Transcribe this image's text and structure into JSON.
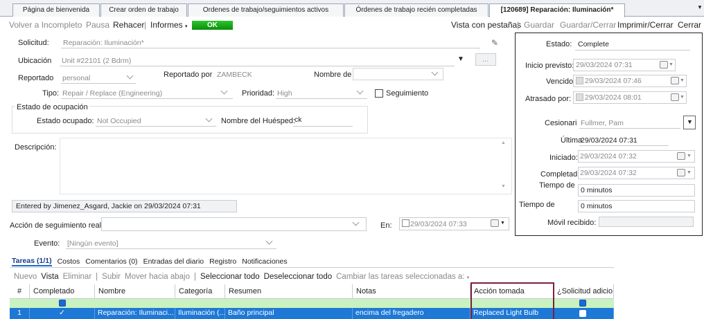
{
  "tabs": [
    "Página de bienvenida",
    "Crear orden de trabajo",
    "Ordenes de trabajo/seguimientos activos",
    "Órdenes de trabajo recién completadas",
    "[120689] Reparación: Iluminación*"
  ],
  "toolbar": {
    "volver": "Volver a Incompleto",
    "pausa": "Pausa",
    "rehacer": "Rehacer",
    "informes": "Informes",
    "ok": "OK",
    "vista": "Vista con pestañas",
    "guardar": "Guardar",
    "guardar_cerrar": "Guardar/Cerrar",
    "imprimir": "Imprimir/Cerrar",
    "cerrar": "Cerrar"
  },
  "form": {
    "solicitud_label": "Solicitud:",
    "solicitud_value": "Reparación: Iluminación*",
    "ubicacion_label": "Ubicación",
    "ubicacion_value": "Unit #22101 (2 Bdrm)",
    "reportado_label": "Reportado",
    "reportado_value": "personal",
    "reportado_por_label": "Reportado por",
    "reportado_por_value": "ZAMBECK",
    "nombre_de_label": "Nombre de",
    "tipo_label": "Tipo:",
    "tipo_value": "Repair / Replace (Engineering)",
    "prioridad_label": "Prioridad:",
    "prioridad_value": "High",
    "seguimiento_label": "Seguimiento",
    "ocupacion_title": "Estado de ocupación",
    "estado_ocupado_label": "Estado ocupado:",
    "estado_ocupado_value": "Not Occupied",
    "huesped_label": "Nombre del Huésped:",
    "huesped_value": "ck",
    "descripcion_label": "Descripción:",
    "entered_by": "Entered by Jimenez_Asgard, Jackie on 29/03/2024 07:31",
    "accion_label": "Acción de seguimiento realiz",
    "en_label": "En:",
    "en_value": "29/03/2024 07:33",
    "evento_label": "Evento:",
    "evento_value": "[Ningún evento]"
  },
  "right": {
    "estado_label": "Estado:",
    "estado_value": "Complete",
    "inicio_label": "Inicio previsto:",
    "inicio_value": "29/03/2024 07:31",
    "vencido_label": "Vencido",
    "vencido_value": "29/03/2024 07:46",
    "atrasado_label": "Atrasado por:",
    "atrasado_value": "29/03/2024 08:01",
    "cesionario_label": "Cesionari",
    "cesionario_value": "Fullmer, Pam",
    "ultima_label": "Última",
    "ultima_value": "29/03/2024 07:31",
    "iniciado_label": "Iniciado:",
    "iniciado_value": "29/03/2024 07:32",
    "completad_label": "Completad",
    "completad_value": "29/03/2024 07:32",
    "tiempo1_label": "Tiempo de",
    "tiempo1_value": "0 minutos",
    "tiempo2_label": "Tiempo de",
    "tiempo2_value": "0 minutos",
    "movil_label": "Móvil recibido:"
  },
  "subtabs": [
    "Tareas (1/1)",
    "Costos",
    "Comentarios (0)",
    "Entradas del diario",
    "Registro",
    "Notificaciones"
  ],
  "tasks_toolbar": [
    "Nuevo",
    "Vista",
    "Eliminar",
    "Subir",
    "Mover hacia abajo",
    "Seleccionar todo",
    "Deseleccionar todo",
    "Cambiar las tareas seleccionadas a:"
  ],
  "grid": {
    "headers": [
      "#",
      "Completado",
      "Nombre",
      "Categoría",
      "Resumen",
      "Notas",
      "Acción tomada",
      "¿Solicitud adicio"
    ],
    "row": [
      "1",
      "✓",
      "Reparación: Iluminaci...",
      "Iluminación (...",
      "Baño principal",
      "encima del fregadero",
      "Replaced Light Bulb",
      ""
    ]
  },
  "colors": {
    "ok_green": "#11a611",
    "selected_row": "#1e78d6",
    "new_row": "#c8f2c0",
    "highlight_border": "#7a1f3d"
  }
}
